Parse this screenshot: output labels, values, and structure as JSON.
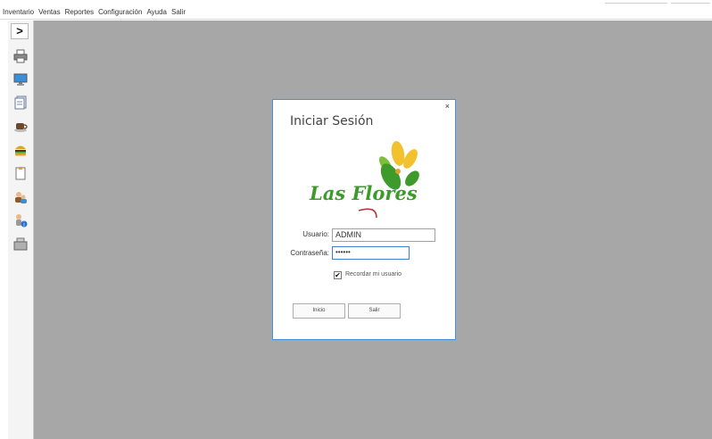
{
  "menubar": {
    "items": [
      "Inventario",
      "Ventas",
      "Reportes",
      "Configuración",
      "Ayuda",
      "Salir"
    ]
  },
  "sidebar": {
    "expand_label": ">",
    "tools": [
      {
        "icon": "printer-icon"
      },
      {
        "icon": "monitor-icon"
      },
      {
        "icon": "document-icon"
      },
      {
        "icon": "coffee-cup-icon"
      },
      {
        "icon": "burger-icon"
      },
      {
        "icon": "clipboard-icon"
      },
      {
        "icon": "users-icon"
      },
      {
        "icon": "user-info-icon"
      },
      {
        "icon": "cash-register-icon"
      }
    ]
  },
  "dialog": {
    "title": "Iniciar Sesión",
    "close_label": "×",
    "logo_text": "Las Flores",
    "username_label": "Usuario:",
    "username_value": "ADMIN",
    "password_label": "Contraseña:",
    "password_value": "••••••",
    "remember_label": "Recordar mi usuario",
    "remember_checked_mark": "✔",
    "login_button": "Inicio",
    "exit_button": "Salir"
  },
  "colors": {
    "workspace": "#a7a7a7",
    "dialog_border": "#4a90d9",
    "logo_green": "#3e9a2a",
    "logo_yellow": "#f2c12e"
  }
}
